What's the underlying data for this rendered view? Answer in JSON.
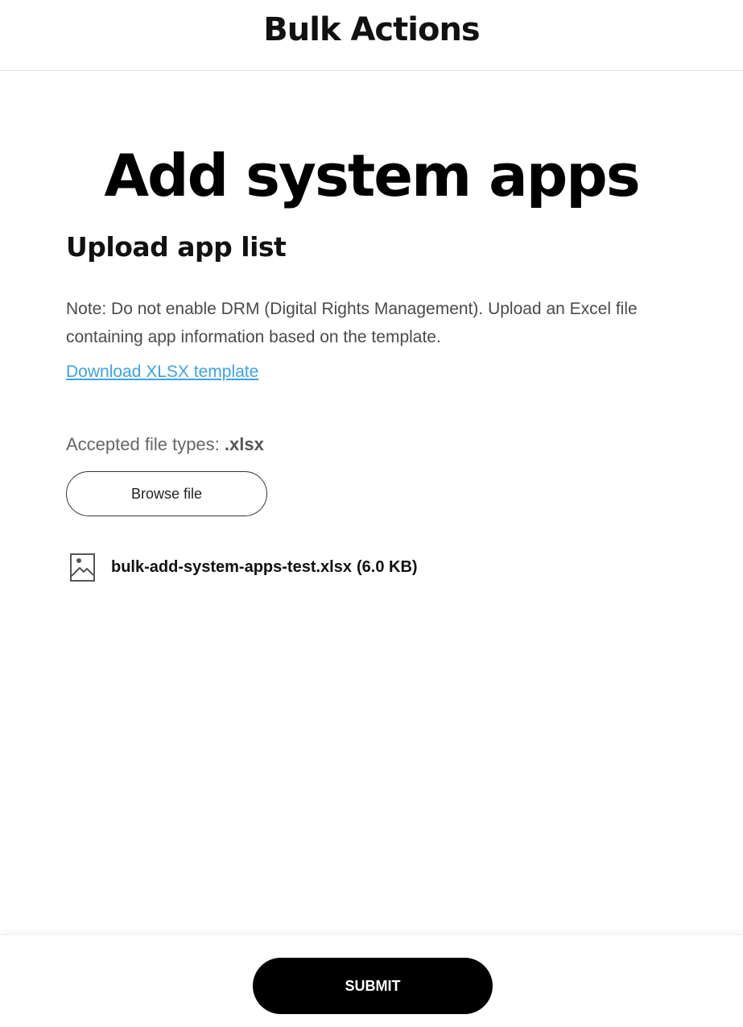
{
  "header": {
    "title": "Bulk Actions"
  },
  "main": {
    "title": "Add system apps",
    "section_title": "Upload app list",
    "note": "Note: Do not enable DRM (Digital Rights Management). Upload an Excel file containing app information based on the template.",
    "template_link": "Download XLSX template",
    "accepted_label": "Accepted file types: ",
    "accepted_ext": ".xlsx",
    "browse_label": "Browse file",
    "file": {
      "name": "bulk-add-system-apps-test.xlsx",
      "size": "(6.0 KB)",
      "icon": "image-icon"
    }
  },
  "footer": {
    "submit_label": "SUBMIT"
  },
  "colors": {
    "link": "#3da2e8",
    "submit_bg": "#000000",
    "submit_text": "#ffffff"
  }
}
